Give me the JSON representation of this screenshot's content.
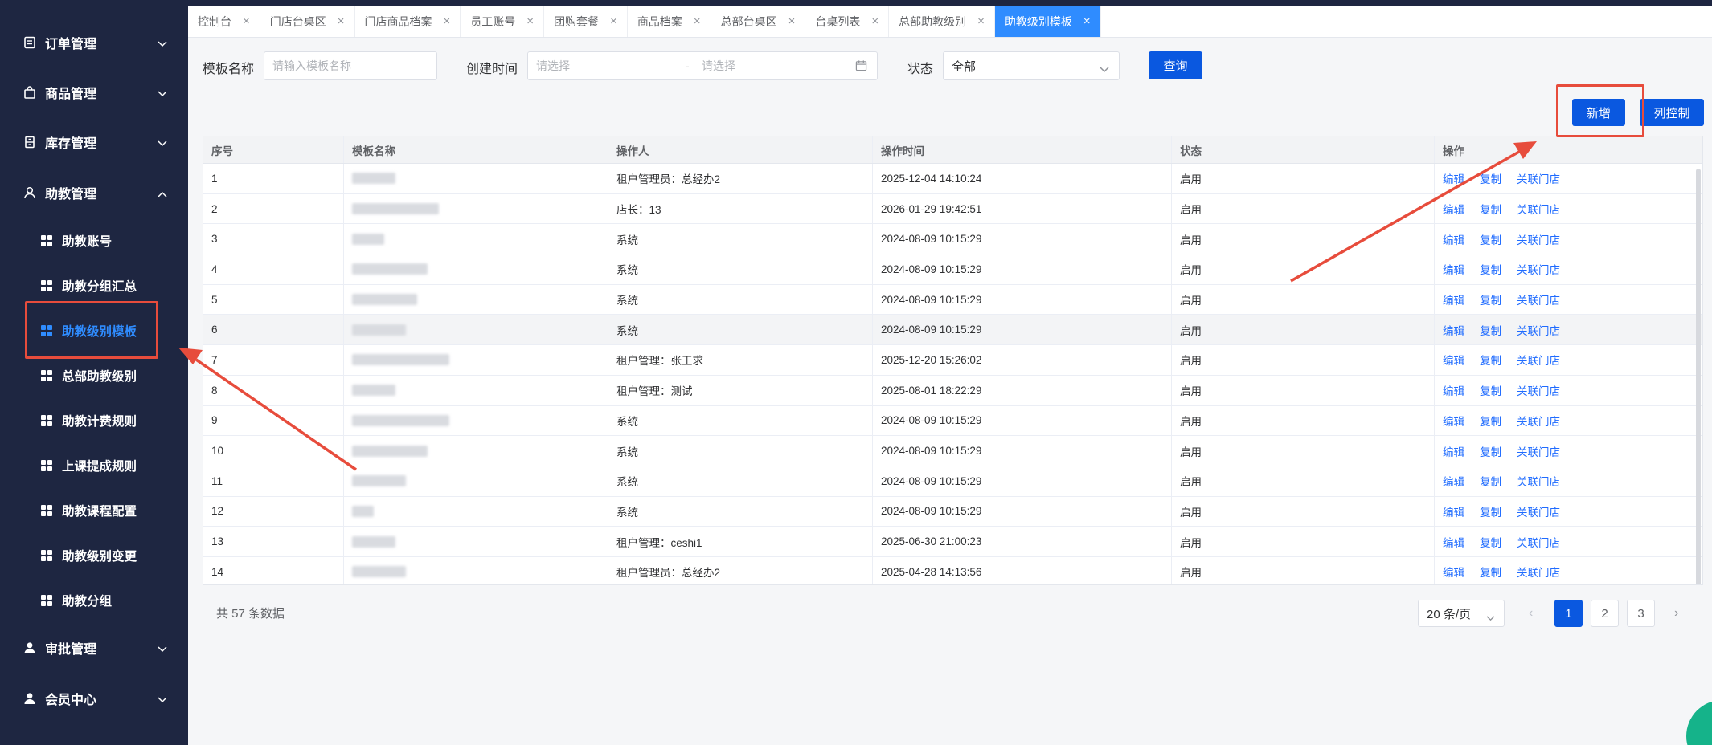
{
  "sidebar": {
    "groups": [
      {
        "label": "订单管理",
        "expanded": false,
        "icon": "document-icon"
      },
      {
        "label": "商品管理",
        "expanded": false,
        "icon": "bag-icon"
      },
      {
        "label": "库存管理",
        "expanded": false,
        "icon": "storage-icon"
      },
      {
        "label": "助教管理",
        "expanded": true,
        "icon": "user-outline-icon"
      },
      {
        "label": "审批管理",
        "expanded": false,
        "icon": "user-solid-icon"
      },
      {
        "label": "会员中心",
        "expanded": false,
        "icon": "user-solid-icon"
      }
    ],
    "sub_items": [
      "助教账号",
      "助教分组汇总",
      "助教级别模板",
      "总部助教级别",
      "助教计费规则",
      "上课提成规则",
      "助教课程配置",
      "助教级别变更",
      "助教分组"
    ],
    "active_sub_item": "助教级别模板"
  },
  "tabs": [
    {
      "label": "控制台",
      "active": false
    },
    {
      "label": "门店台桌区",
      "active": false
    },
    {
      "label": "门店商品档案",
      "active": false
    },
    {
      "label": "员工账号",
      "active": false
    },
    {
      "label": "团购套餐",
      "active": false
    },
    {
      "label": "商品档案",
      "active": false
    },
    {
      "label": "总部台桌区",
      "active": false
    },
    {
      "label": "台桌列表",
      "active": false
    },
    {
      "label": "总部助教级别",
      "active": false
    },
    {
      "label": "助教级别模板",
      "active": true
    }
  ],
  "filters": {
    "name_label": "模板名称",
    "name_placeholder": "请输入模板名称",
    "created_label": "创建时间",
    "date_start_placeholder": "请选择",
    "date_sep": "-",
    "date_end_placeholder": "请选择",
    "status_label": "状态",
    "status_value": "全部",
    "query_button": "查询"
  },
  "actions": {
    "add_button": "新增",
    "columns_button": "列控制"
  },
  "table": {
    "columns": [
      "序号",
      "模板名称",
      "操作人",
      "操作时间",
      "状态",
      "操作"
    ],
    "row_actions": [
      "编辑",
      "复制",
      "关联门店"
    ],
    "rows": [
      {
        "no": "1",
        "operator": "租户管理员：总经办2",
        "time": "2025-12-04 14:10:24",
        "status": "启用"
      },
      {
        "no": "2",
        "operator": "店长：13",
        "time": "2026-01-29 19:42:51",
        "status": "启用"
      },
      {
        "no": "3",
        "operator": "系统",
        "time": "2024-08-09 10:15:29",
        "status": "启用"
      },
      {
        "no": "4",
        "operator": "系统",
        "time": "2024-08-09 10:15:29",
        "status": "启用"
      },
      {
        "no": "5",
        "operator": "系统",
        "time": "2024-08-09 10:15:29",
        "status": "启用"
      },
      {
        "no": "6",
        "operator": "系统",
        "time": "2024-08-09 10:15:29",
        "status": "启用"
      },
      {
        "no": "7",
        "operator": "租户管理：张王求",
        "time": "2025-12-20 15:26:02",
        "status": "启用"
      },
      {
        "no": "8",
        "operator": "租户管理：测试",
        "time": "2025-08-01 18:22:29",
        "status": "启用"
      },
      {
        "no": "9",
        "operator": "系统",
        "time": "2024-08-09 10:15:29",
        "status": "启用"
      },
      {
        "no": "10",
        "operator": "系统",
        "time": "2024-08-09 10:15:29",
        "status": "启用"
      },
      {
        "no": "11",
        "operator": "系统",
        "time": "2024-08-09 10:15:29",
        "status": "启用"
      },
      {
        "no": "12",
        "operator": "系统",
        "time": "2024-08-09 10:15:29",
        "status": "启用"
      },
      {
        "no": "13",
        "operator": "租户管理：ceshi1",
        "time": "2025-06-30 21:00:23",
        "status": "启用"
      },
      {
        "no": "14",
        "operator": "租户管理员：总经办2",
        "time": "2025-04-28 14:13:56",
        "status": "启用"
      }
    ]
  },
  "pagination": {
    "total_text": "共 57 条数据",
    "page_size": "20 条/页",
    "pages": [
      "1",
      "2",
      "3"
    ],
    "current": "1",
    "prev_icon": "chevron-left-icon",
    "next_icon": "chevron-right-icon"
  },
  "colors": {
    "sidebar_bg": "#1e2641",
    "primary": "#0a58e0",
    "active_tab": "#2f8cff",
    "link": "#1f6bff",
    "annotation_red": "#e74c3c"
  }
}
